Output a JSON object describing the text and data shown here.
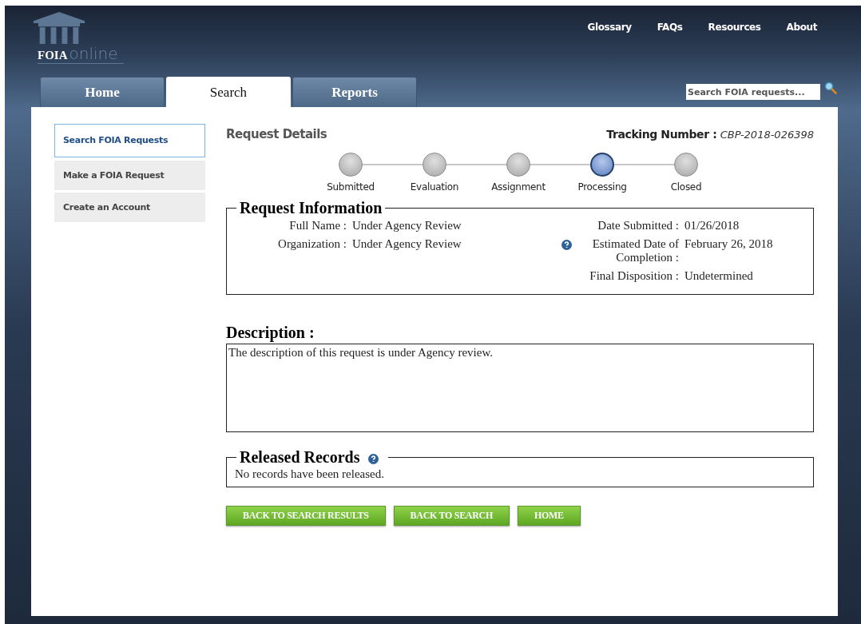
{
  "logo": {
    "bold": "FOIA",
    "light": "online"
  },
  "top_links": [
    "Glossary",
    "FAQs",
    "Resources",
    "About"
  ],
  "tabs": [
    {
      "label": "Home",
      "selected": false
    },
    {
      "label": "Search",
      "selected": true
    },
    {
      "label": "Reports",
      "selected": false
    }
  ],
  "search": {
    "placeholder": "Search FOIA requests..."
  },
  "sidebar": {
    "items": [
      {
        "label": "Search FOIA Requests",
        "selected": true
      },
      {
        "label": "Make a FOIA Request",
        "selected": false
      },
      {
        "label": "Create an Account",
        "selected": false
      }
    ]
  },
  "request_details": {
    "title": "Request Details",
    "tracking_label": "Tracking Number :",
    "tracking_number": "CBP-2018-026398"
  },
  "progress": [
    {
      "label": "Submitted",
      "active": false
    },
    {
      "label": "Evaluation",
      "active": false
    },
    {
      "label": "Assignment",
      "active": false
    },
    {
      "label": "Processing",
      "active": true
    },
    {
      "label": "Closed",
      "active": false
    }
  ],
  "request_information": {
    "title": "Request Information",
    "left": [
      {
        "label": "Full Name :",
        "value": "Under Agency Review"
      },
      {
        "label": "Organization :",
        "value": "Under Agency Review"
      }
    ],
    "right": [
      {
        "label": "Date Submitted :",
        "value": "01/26/2018",
        "help": false
      },
      {
        "label": "Estimated Date of Completion :",
        "value": "February 26, 2018",
        "help": true
      },
      {
        "label": "Final Disposition :",
        "value": "Undetermined",
        "help": false
      }
    ]
  },
  "description": {
    "title": "Description :",
    "text": "The description of this request is under Agency review."
  },
  "released_records": {
    "title": "Released Records",
    "help": true,
    "text": "No records have been released."
  },
  "buttons": [
    "BACK TO SEARCH RESULTS",
    "BACK TO SEARCH",
    "HOME"
  ]
}
